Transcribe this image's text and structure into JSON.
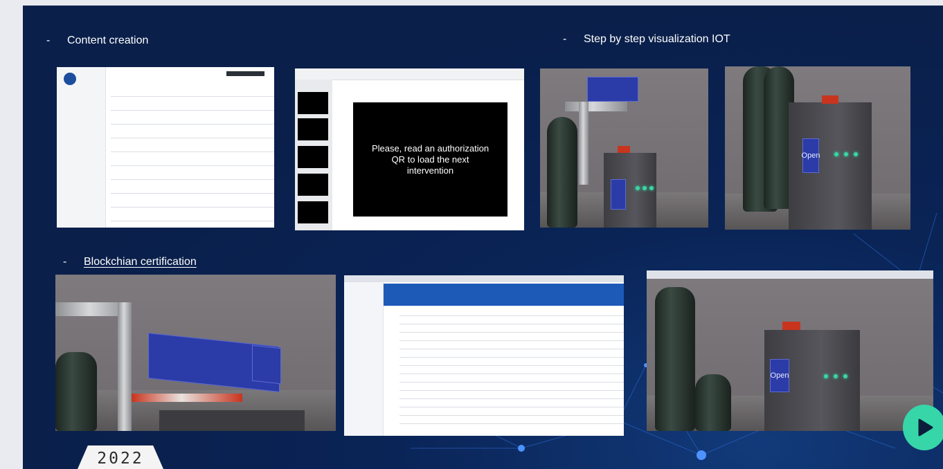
{
  "sections": {
    "content_creation": {
      "dash": "-",
      "label": "Content creation"
    },
    "step_by_step": {
      "dash": "-",
      "label": "Step by step visualization IOT"
    },
    "blockchain": {
      "dash": "-",
      "label": "Blockchian certification"
    }
  },
  "authorization_screen": {
    "line1": "Please, read an authorization",
    "line2": "QR to load the next",
    "line3": "intervention"
  },
  "device_label": "Open",
  "year_badge": "2022",
  "icons": {
    "play": "play-icon"
  },
  "colors": {
    "slide_bg": "#0a1f4a",
    "play_button": "#37d6a9",
    "panel_blue": "#2b3ba8",
    "valve_red": "#c8341e"
  }
}
